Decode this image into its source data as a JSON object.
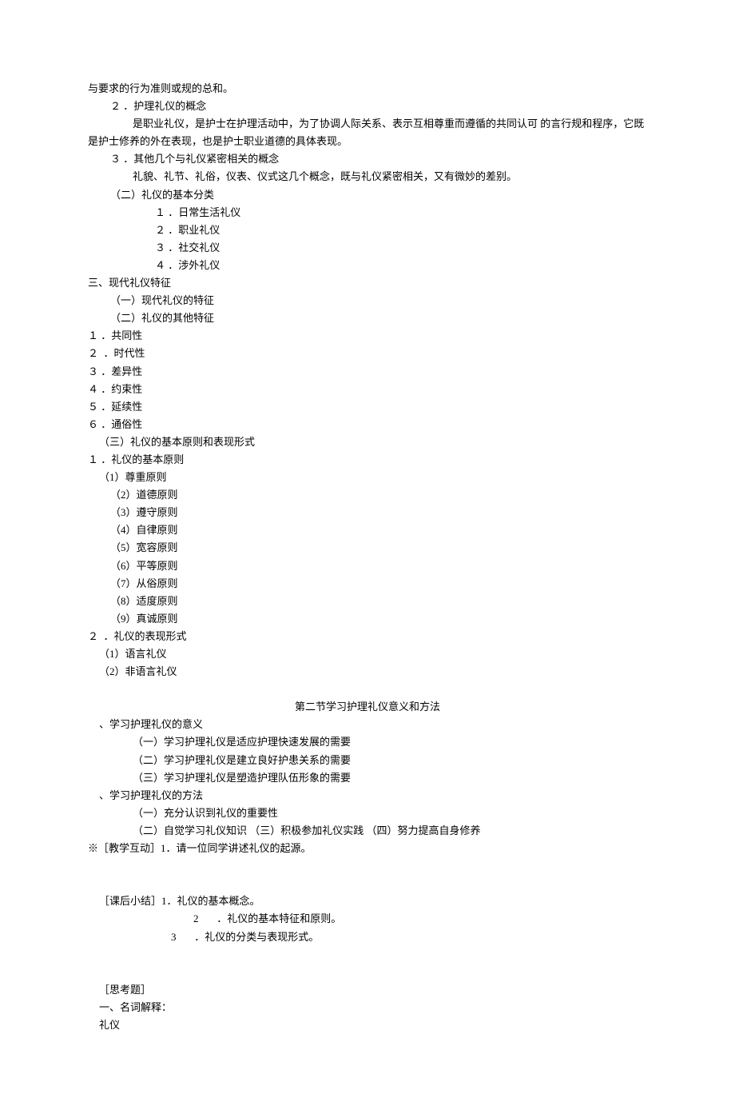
{
  "lines": [
    {
      "text": "与要求的行为准则或规的总和。",
      "indent": 0
    },
    {
      "text": "２ ．护理礼仪的概念",
      "indent": 28
    },
    {
      "text": "是职业礼仪，是护士在护理活动中，为了协调人际关系、表示互相尊重而遵循的共同认可 的言行规和程序，它既",
      "indent": 56
    },
    {
      "text": "是护士修养的外在表现，也是护士职业道德的具体表现。",
      "indent": 0
    },
    {
      "text": "３ ．其他几个与礼仪紧密相关的概念",
      "indent": 28
    },
    {
      "text": "礼貌、礼节、礼俗，仪表、仪式这几个概念，既与礼仪紧密相关，又有微妙的差别。",
      "indent": 56
    },
    {
      "text": "（二）礼仪的基本分类",
      "indent": 28
    },
    {
      "text": "１ ．日常生活礼仪",
      "indent": 84
    },
    {
      "text": "２ ．职业礼仪",
      "indent": 84
    },
    {
      "text": "３ ．社交礼仪",
      "indent": 84
    },
    {
      "text": "４ ．涉外礼仪",
      "indent": 84
    },
    {
      "text": "三、现代礼仪特征",
      "indent": 0
    },
    {
      "text": "（一）现代礼仪的特征",
      "indent": 28
    },
    {
      "text": "（二）礼仪的其他特征",
      "indent": 28
    },
    {
      "text": "１ ．共同性",
      "indent": 0
    },
    {
      "text": "２  ．时代性",
      "indent": 0
    },
    {
      "text": "３ ．差异性",
      "indent": 0
    },
    {
      "text": "４ ．约束性",
      "indent": 0
    },
    {
      "text": "５ ．延续性",
      "indent": 0
    },
    {
      "text": "６ ．通俗性",
      "indent": 0
    },
    {
      "text": "（三）礼仪的基本原则和表现形式",
      "indent": 14
    },
    {
      "text": "１ ．礼仪的基本原则",
      "indent": 0
    },
    {
      "text": "（1）尊重原则",
      "indent": 14
    },
    {
      "text": "（2）道德原则",
      "indent": 28
    },
    {
      "text": "（3）遵守原则",
      "indent": 28
    },
    {
      "text": "（4）自律原则",
      "indent": 28
    },
    {
      "text": "（5）宽容原则",
      "indent": 28
    },
    {
      "text": "（6）平等原则",
      "indent": 28
    },
    {
      "text": "（7）从俗原则",
      "indent": 28
    },
    {
      "text": "（8）适度原则",
      "indent": 28
    },
    {
      "text": "（9）真诚原则",
      "indent": 28
    },
    {
      "text": "２  ．礼仪的表现形式",
      "indent": 0
    },
    {
      "text": "（1）语言礼仪",
      "indent": 14
    },
    {
      "text": "（2）非语言礼仪",
      "indent": 14
    },
    {
      "text": "",
      "indent": 0
    },
    {
      "text": "第二节学习护理礼仪意义和方法",
      "center": true
    },
    {
      "text": "、学习护理礼仪的意义",
      "indent": 14
    },
    {
      "text": "（一）学习护理礼仪是适应护理快速发展的需要",
      "indent": 56
    },
    {
      "text": "（二）学习护理礼仪是建立良好护患关系的需要",
      "indent": 56
    },
    {
      "text": "（三）学习护理礼仪是塑造护理队伍形象的需要",
      "indent": 56
    },
    {
      "text": "、学习护理礼仪的方法",
      "indent": 14
    },
    {
      "text": "（一）充分认识到礼仪的重要性",
      "indent": 56
    },
    {
      "text": "（二）自觉学习礼仪知识 （三）积极参加礼仪实践 （四）努力提高自身修养",
      "indent": 56
    },
    {
      "text": "※［教学互动］1．请一位同学讲述礼仪的起源。",
      "indent": 0
    },
    {
      "text": "",
      "indent": 0
    },
    {
      "text": "",
      "indent": 0
    },
    {
      "text": "［课后小结］1．礼仪的基本概念。",
      "indent": 14
    },
    {
      "text": "2       ．礼仪的基本特征和原则。",
      "indent": 132
    },
    {
      "text": "3       ．礼仪的分类与表现形式。",
      "indent": 104
    },
    {
      "text": "",
      "indent": 0
    },
    {
      "text": "",
      "indent": 0
    },
    {
      "text": "［思考题］",
      "indent": 14
    },
    {
      "text": "一、名词解释：",
      "indent": 14
    },
    {
      "text": "礼仪",
      "indent": 14
    }
  ]
}
